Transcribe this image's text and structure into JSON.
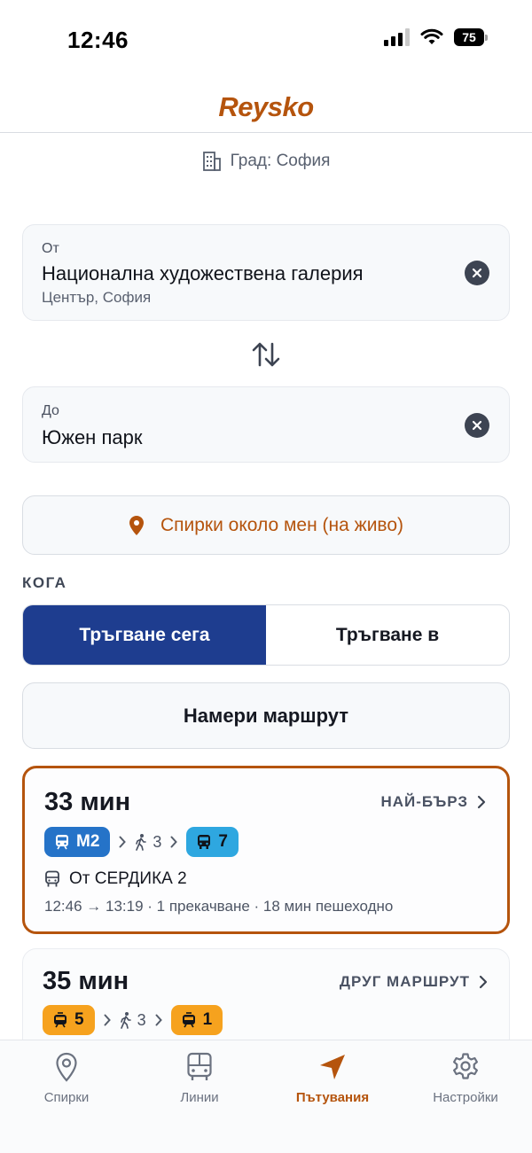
{
  "status": {
    "time": "12:46",
    "battery": "75"
  },
  "header": {
    "brand": "Reysko"
  },
  "city": {
    "label": "Град: София"
  },
  "from": {
    "label": "От",
    "name": "Национална художествена галерия",
    "sub": "Център, София"
  },
  "to": {
    "label": "До",
    "name": "Южен парк"
  },
  "nearby": {
    "label": "Спирки около мен (на живо)"
  },
  "when": {
    "label": "КОГА",
    "options": [
      "Тръгване сега",
      "Тръгване в"
    ],
    "selected": "Тръгване сега"
  },
  "find": {
    "label": "Намери маршрут"
  },
  "routes": [
    {
      "duration": "33 мин",
      "tag": "НАЙ-БЪРЗ",
      "legs": [
        {
          "type": "metro",
          "label": "M2"
        },
        {
          "type": "walk",
          "label": "3"
        },
        {
          "type": "bus",
          "label": "7"
        }
      ],
      "origin": "От СЕРДИКА 2",
      "meta": "12:46 → 13:19 · 1 прекачване · 18 мин пешеходно"
    },
    {
      "duration": "35 мин",
      "tag": "ДРУГ МАРШРУТ",
      "legs": [
        {
          "type": "tram",
          "label": "5"
        },
        {
          "type": "walk",
          "label": "3"
        },
        {
          "type": "tram",
          "label": "1"
        }
      ]
    }
  ],
  "tabs": [
    {
      "label": "Спирки",
      "icon": "map-pin-icon"
    },
    {
      "label": "Линии",
      "icon": "bus-icon"
    },
    {
      "label": "Пътувания",
      "icon": "navigation-arrow-icon"
    },
    {
      "label": "Настройки",
      "icon": "gear-icon"
    }
  ],
  "active_tab": "Пътувания",
  "colors": {
    "accent": "#b5540d",
    "primary": "#1e3d8f",
    "metro": "#2573c8",
    "bus": "#2ea7e0",
    "tram": "#f6a21e"
  }
}
